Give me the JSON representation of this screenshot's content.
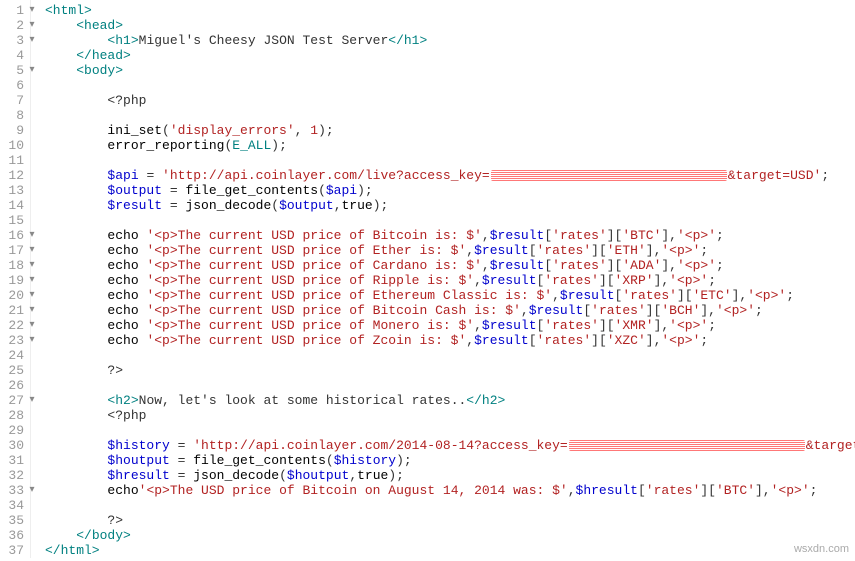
{
  "lines": [
    {
      "n": 1,
      "fold": true,
      "tokens": [
        {
          "t": "<html>",
          "c": "t-tag"
        }
      ]
    },
    {
      "n": 2,
      "fold": true,
      "indent": 1,
      "tokens": [
        {
          "t": "<head>",
          "c": "t-tag"
        }
      ]
    },
    {
      "n": 3,
      "fold": true,
      "indent": 2,
      "tokens": [
        {
          "t": "<h1>",
          "c": "t-tag"
        },
        {
          "t": "Miguel's Cheesy JSON Test Server",
          "c": "t-txt"
        },
        {
          "t": "</h1>",
          "c": "t-tag"
        }
      ]
    },
    {
      "n": 4,
      "indent": 1,
      "tokens": [
        {
          "t": "</head>",
          "c": "t-tag"
        }
      ]
    },
    {
      "n": 5,
      "fold": true,
      "indent": 1,
      "tokens": [
        {
          "t": "<body>",
          "c": "t-tag"
        }
      ]
    },
    {
      "n": 6,
      "indent": 0,
      "tokens": []
    },
    {
      "n": 7,
      "indent": 2,
      "tokens": [
        {
          "t": "<?php",
          "c": "t-txt"
        }
      ]
    },
    {
      "n": 8,
      "indent": 0,
      "tokens": []
    },
    {
      "n": 9,
      "indent": 2,
      "tokens": [
        {
          "t": "ini_set",
          "c": "t-func"
        },
        {
          "t": "(",
          "c": "t-op"
        },
        {
          "t": "'display_errors'",
          "c": "t-str"
        },
        {
          "t": ", ",
          "c": "t-op"
        },
        {
          "t": "1",
          "c": "t-num"
        },
        {
          "t": ");",
          "c": "t-op"
        }
      ]
    },
    {
      "n": 10,
      "indent": 2,
      "tokens": [
        {
          "t": "error_reporting",
          "c": "t-func"
        },
        {
          "t": "(",
          "c": "t-op"
        },
        {
          "t": "E_ALL",
          "c": "t-const"
        },
        {
          "t": ");",
          "c": "t-op"
        }
      ]
    },
    {
      "n": 11,
      "indent": 0,
      "tokens": []
    },
    {
      "n": 12,
      "indent": 2,
      "tokens": [
        {
          "t": "$api",
          "c": "t-var"
        },
        {
          "t": " = ",
          "c": "t-op"
        },
        {
          "t": "'http://api.coinlayer.com/live?access_key=",
          "c": "t-str"
        },
        {
          "redact": 236
        },
        {
          "t": "&target=USD'",
          "c": "t-str"
        },
        {
          "t": ";",
          "c": "t-op"
        }
      ]
    },
    {
      "n": 13,
      "indent": 2,
      "tokens": [
        {
          "t": "$output",
          "c": "t-var"
        },
        {
          "t": " = ",
          "c": "t-op"
        },
        {
          "t": "file_get_contents",
          "c": "t-func"
        },
        {
          "t": "(",
          "c": "t-op"
        },
        {
          "t": "$api",
          "c": "t-var"
        },
        {
          "t": ");",
          "c": "t-op"
        }
      ]
    },
    {
      "n": 14,
      "indent": 2,
      "tokens": [
        {
          "t": "$result",
          "c": "t-var"
        },
        {
          "t": " = ",
          "c": "t-op"
        },
        {
          "t": "json_decode",
          "c": "t-func"
        },
        {
          "t": "(",
          "c": "t-op"
        },
        {
          "t": "$output",
          "c": "t-var"
        },
        {
          "t": ",",
          "c": "t-op"
        },
        {
          "t": "true",
          "c": "t-kw"
        },
        {
          "t": ");",
          "c": "t-op"
        }
      ]
    },
    {
      "n": 15,
      "indent": 0,
      "tokens": []
    },
    {
      "n": 16,
      "fold": true,
      "indent": 2,
      "tokens": [
        {
          "t": "echo ",
          "c": "t-kw"
        },
        {
          "t": "'<p>The current USD price of Bitcoin is: $'",
          "c": "t-str"
        },
        {
          "t": ",",
          "c": "t-op"
        },
        {
          "t": "$result",
          "c": "t-var"
        },
        {
          "t": "[",
          "c": "t-op"
        },
        {
          "t": "'rates'",
          "c": "t-str"
        },
        {
          "t": "][",
          "c": "t-op"
        },
        {
          "t": "'BTC'",
          "c": "t-str"
        },
        {
          "t": "],",
          "c": "t-op"
        },
        {
          "t": "'<p>'",
          "c": "t-str"
        },
        {
          "t": ";",
          "c": "t-op"
        }
      ]
    },
    {
      "n": 17,
      "fold": true,
      "indent": 2,
      "tokens": [
        {
          "t": "echo ",
          "c": "t-kw"
        },
        {
          "t": "'<p>The current USD price of Ether is: $'",
          "c": "t-str"
        },
        {
          "t": ",",
          "c": "t-op"
        },
        {
          "t": "$result",
          "c": "t-var"
        },
        {
          "t": "[",
          "c": "t-op"
        },
        {
          "t": "'rates'",
          "c": "t-str"
        },
        {
          "t": "][",
          "c": "t-op"
        },
        {
          "t": "'ETH'",
          "c": "t-str"
        },
        {
          "t": "],",
          "c": "t-op"
        },
        {
          "t": "'<p>'",
          "c": "t-str"
        },
        {
          "t": ";",
          "c": "t-op"
        }
      ]
    },
    {
      "n": 18,
      "fold": true,
      "indent": 2,
      "tokens": [
        {
          "t": "echo ",
          "c": "t-kw"
        },
        {
          "t": "'<p>The current USD price of Cardano is: $'",
          "c": "t-str"
        },
        {
          "t": ",",
          "c": "t-op"
        },
        {
          "t": "$result",
          "c": "t-var"
        },
        {
          "t": "[",
          "c": "t-op"
        },
        {
          "t": "'rates'",
          "c": "t-str"
        },
        {
          "t": "][",
          "c": "t-op"
        },
        {
          "t": "'ADA'",
          "c": "t-str"
        },
        {
          "t": "],",
          "c": "t-op"
        },
        {
          "t": "'<p>'",
          "c": "t-str"
        },
        {
          "t": ";",
          "c": "t-op"
        }
      ]
    },
    {
      "n": 19,
      "fold": true,
      "indent": 2,
      "tokens": [
        {
          "t": "echo ",
          "c": "t-kw"
        },
        {
          "t": "'<p>The current USD price of Ripple is: $'",
          "c": "t-str"
        },
        {
          "t": ",",
          "c": "t-op"
        },
        {
          "t": "$result",
          "c": "t-var"
        },
        {
          "t": "[",
          "c": "t-op"
        },
        {
          "t": "'rates'",
          "c": "t-str"
        },
        {
          "t": "][",
          "c": "t-op"
        },
        {
          "t": "'XRP'",
          "c": "t-str"
        },
        {
          "t": "],",
          "c": "t-op"
        },
        {
          "t": "'<p>'",
          "c": "t-str"
        },
        {
          "t": ";",
          "c": "t-op"
        }
      ]
    },
    {
      "n": 20,
      "fold": true,
      "indent": 2,
      "tokens": [
        {
          "t": "echo ",
          "c": "t-kw"
        },
        {
          "t": "'<p>The current USD price of Ethereum Classic is: $'",
          "c": "t-str"
        },
        {
          "t": ",",
          "c": "t-op"
        },
        {
          "t": "$result",
          "c": "t-var"
        },
        {
          "t": "[",
          "c": "t-op"
        },
        {
          "t": "'rates'",
          "c": "t-str"
        },
        {
          "t": "][",
          "c": "t-op"
        },
        {
          "t": "'ETC'",
          "c": "t-str"
        },
        {
          "t": "],",
          "c": "t-op"
        },
        {
          "t": "'<p>'",
          "c": "t-str"
        },
        {
          "t": ";",
          "c": "t-op"
        }
      ]
    },
    {
      "n": 21,
      "fold": true,
      "indent": 2,
      "tokens": [
        {
          "t": "echo ",
          "c": "t-kw"
        },
        {
          "t": "'<p>The current USD price of Bitcoin Cash is: $'",
          "c": "t-str"
        },
        {
          "t": ",",
          "c": "t-op"
        },
        {
          "t": "$result",
          "c": "t-var"
        },
        {
          "t": "[",
          "c": "t-op"
        },
        {
          "t": "'rates'",
          "c": "t-str"
        },
        {
          "t": "][",
          "c": "t-op"
        },
        {
          "t": "'BCH'",
          "c": "t-str"
        },
        {
          "t": "],",
          "c": "t-op"
        },
        {
          "t": "'<p>'",
          "c": "t-str"
        },
        {
          "t": ";",
          "c": "t-op"
        }
      ]
    },
    {
      "n": 22,
      "fold": true,
      "indent": 2,
      "tokens": [
        {
          "t": "echo ",
          "c": "t-kw"
        },
        {
          "t": "'<p>The current USD price of Monero is: $'",
          "c": "t-str"
        },
        {
          "t": ",",
          "c": "t-op"
        },
        {
          "t": "$result",
          "c": "t-var"
        },
        {
          "t": "[",
          "c": "t-op"
        },
        {
          "t": "'rates'",
          "c": "t-str"
        },
        {
          "t": "][",
          "c": "t-op"
        },
        {
          "t": "'XMR'",
          "c": "t-str"
        },
        {
          "t": "],",
          "c": "t-op"
        },
        {
          "t": "'<p>'",
          "c": "t-str"
        },
        {
          "t": ";",
          "c": "t-op"
        }
      ]
    },
    {
      "n": 23,
      "fold": true,
      "indent": 2,
      "tokens": [
        {
          "t": "echo ",
          "c": "t-kw"
        },
        {
          "t": "'<p>The current USD price of Zcoin is: $'",
          "c": "t-str"
        },
        {
          "t": ",",
          "c": "t-op"
        },
        {
          "t": "$result",
          "c": "t-var"
        },
        {
          "t": "[",
          "c": "t-op"
        },
        {
          "t": "'rates'",
          "c": "t-str"
        },
        {
          "t": "][",
          "c": "t-op"
        },
        {
          "t": "'XZC'",
          "c": "t-str"
        },
        {
          "t": "],",
          "c": "t-op"
        },
        {
          "t": "'<p>'",
          "c": "t-str"
        },
        {
          "t": ";",
          "c": "t-op"
        }
      ]
    },
    {
      "n": 24,
      "indent": 0,
      "tokens": []
    },
    {
      "n": 25,
      "indent": 2,
      "tokens": [
        {
          "t": "?>",
          "c": "t-txt"
        }
      ]
    },
    {
      "n": 26,
      "indent": 0,
      "tokens": []
    },
    {
      "n": 27,
      "fold": true,
      "indent": 2,
      "tokens": [
        {
          "t": "<h2>",
          "c": "t-tag"
        },
        {
          "t": "Now, let's look at some historical rates..",
          "c": "t-txt"
        },
        {
          "t": "</h2>",
          "c": "t-tag"
        }
      ]
    },
    {
      "n": 28,
      "indent": 2,
      "tokens": [
        {
          "t": "<?php",
          "c": "t-txt"
        }
      ]
    },
    {
      "n": 29,
      "indent": 0,
      "tokens": []
    },
    {
      "n": 30,
      "indent": 2,
      "tokens": [
        {
          "t": "$history",
          "c": "t-var"
        },
        {
          "t": " = ",
          "c": "t-op"
        },
        {
          "t": "'http://api.coinlayer.com/2014-08-14?access_key=",
          "c": "t-str"
        },
        {
          "redact": 236
        },
        {
          "t": "&target=USD'",
          "c": "t-str"
        },
        {
          "t": ";",
          "c": "t-op"
        }
      ]
    },
    {
      "n": 31,
      "indent": 2,
      "tokens": [
        {
          "t": "$houtput",
          "c": "t-var"
        },
        {
          "t": " = ",
          "c": "t-op"
        },
        {
          "t": "file_get_contents",
          "c": "t-func"
        },
        {
          "t": "(",
          "c": "t-op"
        },
        {
          "t": "$history",
          "c": "t-var"
        },
        {
          "t": ");",
          "c": "t-op"
        }
      ]
    },
    {
      "n": 32,
      "indent": 2,
      "tokens": [
        {
          "t": "$hresult",
          "c": "t-var"
        },
        {
          "t": " = ",
          "c": "t-op"
        },
        {
          "t": "json_decode",
          "c": "t-func"
        },
        {
          "t": "(",
          "c": "t-op"
        },
        {
          "t": "$houtput",
          "c": "t-var"
        },
        {
          "t": ",",
          "c": "t-op"
        },
        {
          "t": "true",
          "c": "t-kw"
        },
        {
          "t": ");",
          "c": "t-op"
        }
      ]
    },
    {
      "n": 33,
      "fold": true,
      "indent": 2,
      "tokens": [
        {
          "t": "echo",
          "c": "t-kw"
        },
        {
          "t": "'<p>The USD price of Bitcoin on August 14, 2014 was: $'",
          "c": "t-str"
        },
        {
          "t": ",",
          "c": "t-op"
        },
        {
          "t": "$hresult",
          "c": "t-var"
        },
        {
          "t": "[",
          "c": "t-op"
        },
        {
          "t": "'rates'",
          "c": "t-str"
        },
        {
          "t": "][",
          "c": "t-op"
        },
        {
          "t": "'BTC'",
          "c": "t-str"
        },
        {
          "t": "],",
          "c": "t-op"
        },
        {
          "t": "'<p>'",
          "c": "t-str"
        },
        {
          "t": ";",
          "c": "t-op"
        }
      ]
    },
    {
      "n": 34,
      "indent": 0,
      "tokens": []
    },
    {
      "n": 35,
      "indent": 2,
      "tokens": [
        {
          "t": "?>",
          "c": "t-txt"
        }
      ]
    },
    {
      "n": 36,
      "indent": 1,
      "tokens": [
        {
          "t": "</body>",
          "c": "t-tag"
        }
      ]
    },
    {
      "n": 37,
      "indent": 0,
      "tokens": [
        {
          "t": "</html>",
          "c": "t-tag"
        }
      ]
    }
  ],
  "watermark": "wsxdn.com",
  "indent_unit": "    "
}
